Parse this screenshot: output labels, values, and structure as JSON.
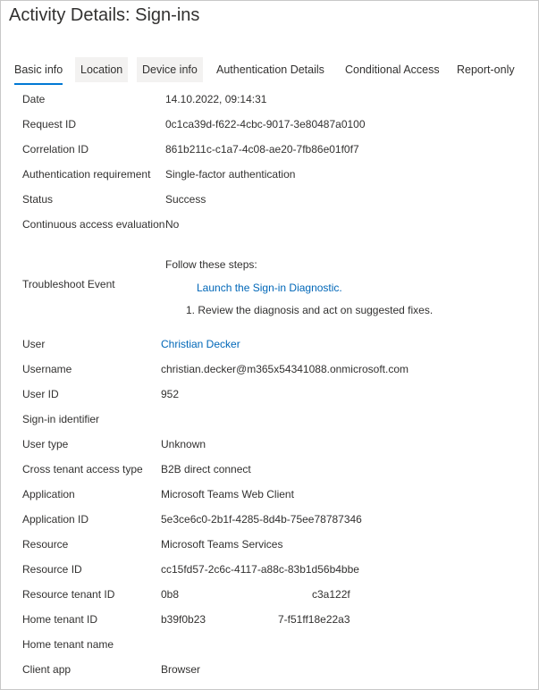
{
  "page": {
    "title": "Activity Details: Sign-ins"
  },
  "tabs": [
    {
      "label": "Basic info"
    },
    {
      "label": "Location"
    },
    {
      "label": "Device info"
    },
    {
      "label": "Authentication Details"
    },
    {
      "label": "Conditional Access"
    },
    {
      "label": "Report-only"
    }
  ],
  "details": {
    "date": {
      "label": "Date",
      "value": "14.10.2022, 09:14:31"
    },
    "request_id": {
      "label": "Request ID",
      "value": "0c1ca39d-f622-4cbc-9017-3e80487a0100"
    },
    "correlation_id": {
      "label": "Correlation ID",
      "value": "861b211c-c1a7-4c08-ae20-7fb86e01f0f7"
    },
    "auth_requirement": {
      "label": "Authentication requirement",
      "value": "Single-factor authentication"
    },
    "status": {
      "label": "Status",
      "value": "Success"
    },
    "cae": {
      "label": "Continuous access evaluation",
      "value": "No"
    },
    "troubleshoot": {
      "label": "Troubleshoot Event",
      "steps_heading": "Follow these steps:",
      "link": "Launch the Sign-in Diagnostic.",
      "step1": "1. Review the diagnosis and act on suggested fixes."
    },
    "user": {
      "label": "User",
      "value": "Christian Decker"
    },
    "username": {
      "label": "Username",
      "value": "christian.decker@m365x54341088.onmicrosoft.com"
    },
    "user_id": {
      "label": "User ID",
      "value": "952"
    },
    "signin_identifier": {
      "label": "Sign-in identifier",
      "value": ""
    },
    "user_type": {
      "label": "User type",
      "value": "Unknown"
    },
    "cross_tenant": {
      "label": "Cross tenant access type",
      "value": "B2B direct connect"
    },
    "application": {
      "label": "Application",
      "value": "Microsoft Teams Web Client"
    },
    "application_id": {
      "label": "Application ID",
      "value": "5e3ce6c0-2b1f-4285-8d4b-75ee78787346"
    },
    "resource": {
      "label": "Resource",
      "value": "Microsoft Teams Services"
    },
    "resource_id": {
      "label": "Resource ID",
      "value": "cc15fd57-2c6c-4117-a88c-83b1d56b4bbe"
    },
    "resource_tenant_id": {
      "label": "Resource tenant ID",
      "value_start": "0b8",
      "value_end": "c3a122f"
    },
    "home_tenant_id": {
      "label": "Home tenant ID",
      "value_start": "b39f0b23",
      "value_end": "7-f51ff18e22a3"
    },
    "home_tenant_name": {
      "label": "Home tenant name",
      "value": ""
    },
    "client_app": {
      "label": "Client app",
      "value": "Browser"
    }
  },
  "colors": {
    "accent": "#0078d4",
    "link": "#0067b8",
    "tab_bg": "#f3f2f1"
  }
}
